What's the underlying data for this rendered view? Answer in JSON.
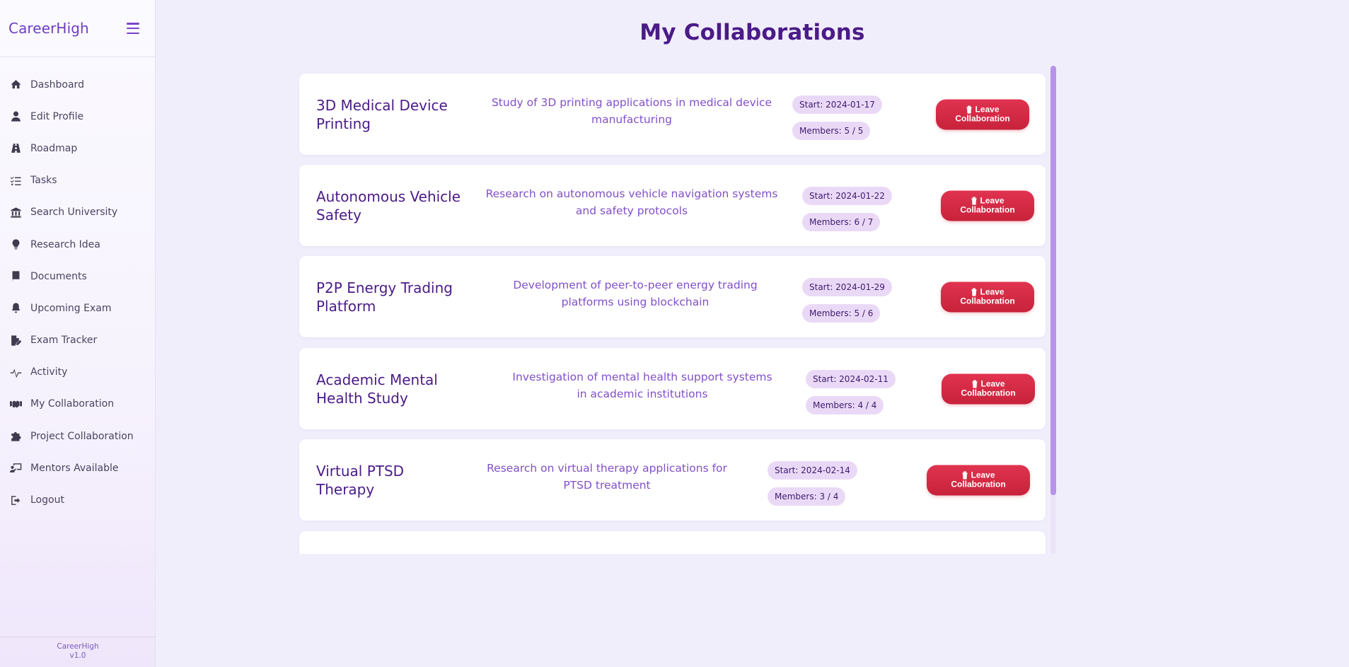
{
  "app": {
    "brand": "CareerHigh"
  },
  "sidebar": {
    "items": [
      {
        "label": "Dashboard",
        "icon": "home-icon"
      },
      {
        "label": "Edit Profile",
        "icon": "user-icon"
      },
      {
        "label": "Roadmap",
        "icon": "road-icon"
      },
      {
        "label": "Tasks",
        "icon": "checklist-icon"
      },
      {
        "label": "Search University",
        "icon": "university-icon"
      },
      {
        "label": "Research Idea",
        "icon": "lightbulb-icon"
      },
      {
        "label": "Documents",
        "icon": "book-icon"
      },
      {
        "label": "Upcoming Exam",
        "icon": "bell-icon"
      },
      {
        "label": "Exam Tracker",
        "icon": "file-pen-icon"
      },
      {
        "label": "Activity",
        "icon": "pulse-icon"
      },
      {
        "label": "My Collaboration",
        "icon": "handshake-icon"
      },
      {
        "label": "Project Collaboration",
        "icon": "puzzle-icon"
      },
      {
        "label": "Mentors Available",
        "icon": "mentor-board-icon"
      },
      {
        "label": "Logout",
        "icon": "logout-icon"
      }
    ],
    "footer": {
      "name": "CareerHigh",
      "version": "v1.0"
    }
  },
  "main": {
    "title": "My Collaborations",
    "leave_label_line1": "Leave",
    "leave_label_line2": "Collaboration",
    "collaborations": [
      {
        "title": "3D Medical Device Printing",
        "description": "Study of 3D printing applications in medical device manufacturing",
        "start": "Start: 2024-01-17",
        "members": "Members: 5 / 5"
      },
      {
        "title": "Autonomous Vehicle Safety",
        "description": "Research on autonomous vehicle navigation systems and safety protocols",
        "start": "Start: 2024-01-22",
        "members": "Members: 6 / 7"
      },
      {
        "title": "P2P Energy Trading Platform",
        "description": "Development of peer-to-peer energy trading platforms using blockchain",
        "start": "Start: 2024-01-29",
        "members": "Members: 5 / 6"
      },
      {
        "title": "Academic Mental Health Study",
        "description": "Investigation of mental health support systems in academic institutions",
        "start": "Start: 2024-02-11",
        "members": "Members: 4 / 4"
      },
      {
        "title": "Virtual PTSD Therapy",
        "description": "Research on virtual therapy applications for PTSD treatment",
        "start": "Start: 2024-02-14",
        "members": "Members: 3 / 4"
      }
    ]
  }
}
